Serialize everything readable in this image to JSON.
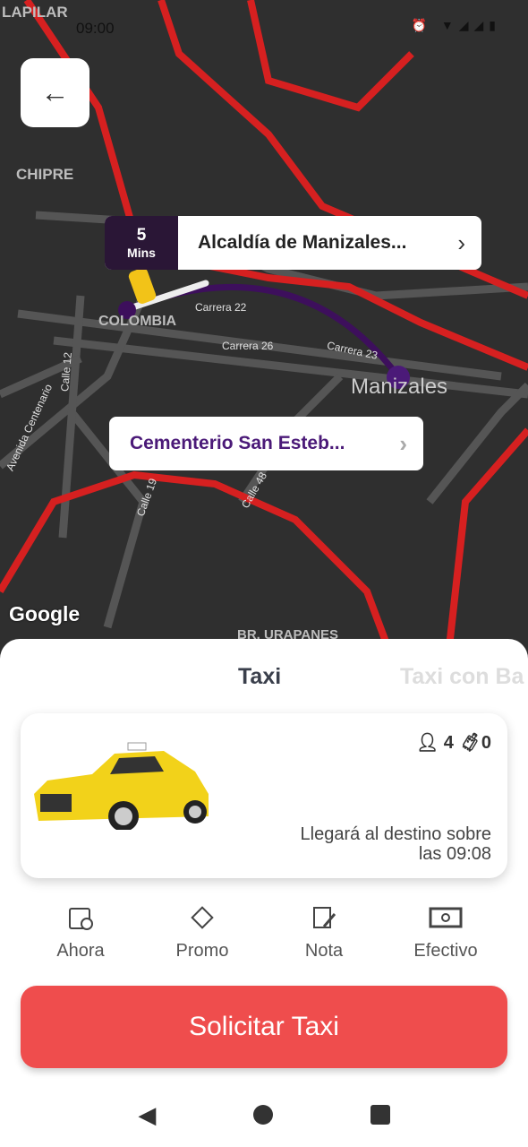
{
  "status_bar": {
    "time": "09:00",
    "icons": [
      "b-icon",
      "gmail-icon",
      "laptop-icon",
      "alarm-icon",
      "volte-icon",
      "wifi-icon",
      "signal-icon",
      "signal-icon",
      "battery-icon"
    ]
  },
  "map": {
    "labels": [
      "LAPILAR",
      "CHIPRE",
      "COLOMBIA",
      "Manizales",
      "BR. URAPANES"
    ],
    "streets": [
      "Carrera 22",
      "Carrera 26",
      "Carrera 23",
      "Calle 12",
      "Avenida Centenario",
      "Calle 19",
      "Calle 48"
    ],
    "attribution": "Google",
    "route_color": "#3d0f5c",
    "road_color": "#d62020"
  },
  "origin": {
    "eta_value": "5",
    "eta_unit": "Mins",
    "name": "Alcaldía de Manizales..."
  },
  "destination": {
    "name": "Cementerio San Esteb..."
  },
  "tabs": [
    {
      "label": "Taxi",
      "active": true
    },
    {
      "label": "Taxi con Ba",
      "active": false
    }
  ],
  "vehicle": {
    "passengers": "4",
    "luggage": "0",
    "arrival_line1": "Llegará al destino sobre",
    "arrival_line2": "las 09:08"
  },
  "options": [
    {
      "label": "Ahora",
      "icon": "calendar-clock-icon"
    },
    {
      "label": "Promo",
      "icon": "ticket-icon"
    },
    {
      "label": "Nota",
      "icon": "note-edit-icon"
    },
    {
      "label": "Efectivo",
      "icon": "cash-icon"
    }
  ],
  "cta": {
    "label": "Solicitar Taxi",
    "color": "#ef4d4d"
  }
}
